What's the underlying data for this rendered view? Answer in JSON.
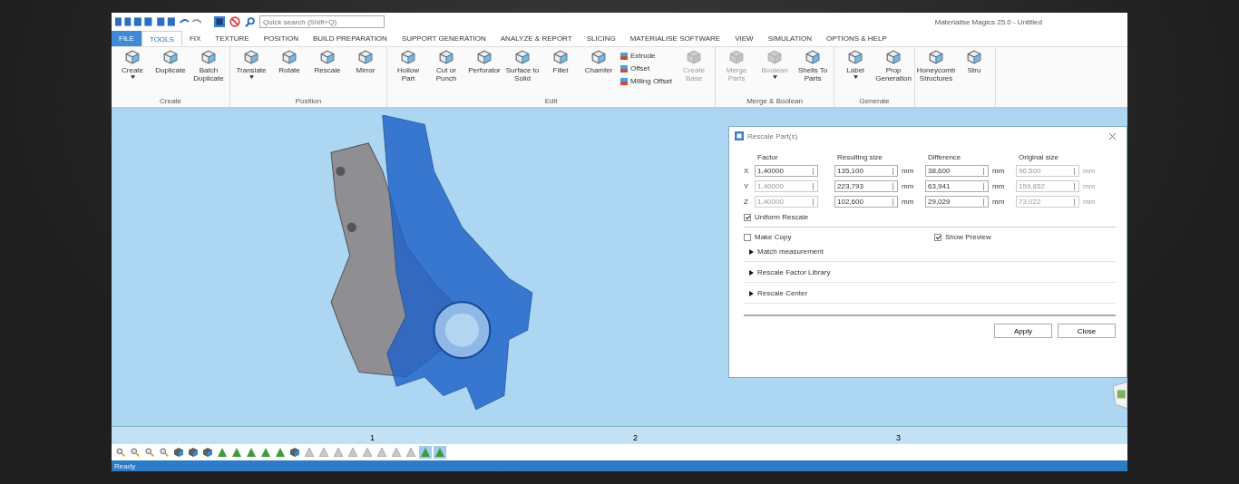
{
  "window": {
    "title": "Materialise Magics 25.0 - Untitled"
  },
  "quick_search": {
    "placeholder": "Quick search (Shift+Q)"
  },
  "tabs": [
    {
      "label": "FILE",
      "kind": "file",
      "selected": false
    },
    {
      "label": "TOOLS",
      "kind": "tab",
      "selected": true
    },
    {
      "label": "FIX",
      "kind": "tab",
      "selected": false
    },
    {
      "label": "TEXTURE",
      "kind": "tab",
      "selected": false
    },
    {
      "label": "POSITION",
      "kind": "tab",
      "selected": false
    },
    {
      "label": "BUILD PREPARATION",
      "kind": "tab",
      "selected": false
    },
    {
      "label": "SUPPORT GENERATION",
      "kind": "tab",
      "selected": false
    },
    {
      "label": "ANALYZE & REPORT",
      "kind": "tab",
      "selected": false
    },
    {
      "label": "SLICING",
      "kind": "tab",
      "selected": false
    },
    {
      "label": "MATERIALISE SOFTWARE",
      "kind": "tab",
      "selected": false
    },
    {
      "label": "VIEW",
      "kind": "tab",
      "selected": false
    },
    {
      "label": "SIMULATION",
      "kind": "tab",
      "selected": false
    },
    {
      "label": "OPTIONS & HELP",
      "kind": "tab",
      "selected": false
    }
  ],
  "ribbon": [
    {
      "label": "Create",
      "buttons": [
        {
          "kind": "large",
          "label": "Create",
          "disabled": false,
          "dropdown": true
        },
        {
          "kind": "large",
          "label": "Duplicate",
          "disabled": false,
          "dropdown": false
        },
        {
          "kind": "large",
          "label": "Batch Duplicate",
          "disabled": false,
          "dropdown": false
        }
      ]
    },
    {
      "label": "Position",
      "buttons": [
        {
          "kind": "large",
          "label": "Translate",
          "disabled": false,
          "dropdown": true
        },
        {
          "kind": "large",
          "label": "Rotate",
          "disabled": false,
          "dropdown": false
        },
        {
          "kind": "large",
          "label": "Rescale",
          "disabled": false,
          "dropdown": false
        },
        {
          "kind": "large",
          "label": "Mirror",
          "disabled": false,
          "dropdown": false
        }
      ]
    },
    {
      "label": "Edit",
      "buttons": [
        {
          "kind": "large",
          "label": "Hollow Part",
          "disabled": false,
          "dropdown": false
        },
        {
          "kind": "large",
          "label": "Cut or Punch",
          "disabled": false,
          "dropdown": false
        },
        {
          "kind": "large",
          "label": "Perforator",
          "disabled": false,
          "dropdown": false
        },
        {
          "kind": "large",
          "label": "Surface to Solid",
          "disabled": false,
          "dropdown": false
        },
        {
          "kind": "large",
          "label": "Fillet",
          "disabled": false,
          "dropdown": false
        },
        {
          "kind": "large",
          "label": "Chamfer",
          "disabled": false,
          "dropdown": false
        },
        {
          "kind": "stack",
          "items": [
            "Extrude",
            "Offset",
            "Milling Offset"
          ]
        },
        {
          "kind": "large",
          "label": "Create Base",
          "disabled": true,
          "dropdown": false
        }
      ]
    },
    {
      "label": "Merge & Boolean",
      "buttons": [
        {
          "kind": "large",
          "label": "Merge Parts",
          "disabled": true,
          "dropdown": false
        },
        {
          "kind": "large",
          "label": "Boolean",
          "disabled": true,
          "dropdown": true
        },
        {
          "kind": "large",
          "label": "Shells To Parts",
          "disabled": false,
          "dropdown": false
        }
      ]
    },
    {
      "label": "Generate",
      "buttons": [
        {
          "kind": "large",
          "label": "Label",
          "disabled": false,
          "dropdown": true
        },
        {
          "kind": "large",
          "label": "Prop Generation",
          "disabled": false,
          "dropdown": false
        }
      ]
    },
    {
      "buttons": [
        {
          "kind": "large",
          "label": "Honeycomb Structures",
          "disabled": false,
          "dropdown": false
        },
        {
          "kind": "large",
          "label": "Stru",
          "disabled": false,
          "dropdown": false
        }
      ]
    }
  ],
  "dialog": {
    "title": "Rescale Part(s)",
    "columns": [
      "Factor",
      "Resulting size",
      "Difference",
      "Original size"
    ],
    "rows": [
      {
        "axis": "X",
        "factor": "1,40000",
        "factor_disabled": false,
        "resulting": "135,100",
        "difference": "38,600",
        "original": "96,500",
        "unit_1": "mm",
        "unit_2": "mm",
        "unit_3": "mm"
      },
      {
        "axis": "Y",
        "factor": "1,40000",
        "factor_disabled": true,
        "resulting": "223,793",
        "difference": "63,941",
        "original": "159,852",
        "unit_1": "mm",
        "unit_2": "mm",
        "unit_3": "mm"
      },
      {
        "axis": "Z",
        "factor": "1,40000",
        "factor_disabled": true,
        "resulting": "102,600",
        "difference": "29,029",
        "original": "73,022",
        "unit_1": "mm",
        "unit_2": "mm",
        "unit_3": "mm"
      }
    ],
    "uniform": {
      "label": "Uniform Rescale",
      "checked": true
    },
    "options": [
      {
        "label": "Make Copy",
        "checked": false
      },
      {
        "label": "Show Preview",
        "checked": true
      }
    ],
    "sections": [
      {
        "label": "Match measurement",
        "expanded": false
      },
      {
        "label": "Rescale Factor Library",
        "expanded": false
      },
      {
        "label": "Rescale Center",
        "expanded": false
      }
    ],
    "buttons": [
      "Apply",
      "Close"
    ]
  },
  "ruler": {
    "labels": [
      "1",
      "2",
      "3"
    ]
  },
  "view_toolbar": [
    {
      "kind": "zoom",
      "selected": false
    },
    {
      "kind": "zoom",
      "selected": false
    },
    {
      "kind": "zoom",
      "selected": false
    },
    {
      "kind": "zoom",
      "selected": false
    },
    {
      "kind": "cube",
      "selected": false
    },
    {
      "kind": "cube",
      "selected": false
    },
    {
      "kind": "cube",
      "selected": false
    },
    {
      "kind": "green",
      "selected": false
    },
    {
      "kind": "green",
      "selected": false
    },
    {
      "kind": "green",
      "selected": false
    },
    {
      "kind": "green",
      "selected": false
    },
    {
      "kind": "green",
      "selected": false
    },
    {
      "kind": "cube",
      "selected": false
    },
    {
      "kind": "pyramid",
      "selected": false
    },
    {
      "kind": "pyramid",
      "selected": false
    },
    {
      "kind": "pyramid",
      "selected": false
    },
    {
      "kind": "pyramid",
      "selected": false
    },
    {
      "kind": "pyramid",
      "selected": false
    },
    {
      "kind": "pyramid",
      "selected": false
    },
    {
      "kind": "pyramid",
      "selected": false
    },
    {
      "kind": "pyramid",
      "selected": false
    },
    {
      "kind": "green",
      "selected": true
    },
    {
      "kind": "green",
      "selected": true
    }
  ],
  "status_bar": {
    "text": "Ready"
  }
}
